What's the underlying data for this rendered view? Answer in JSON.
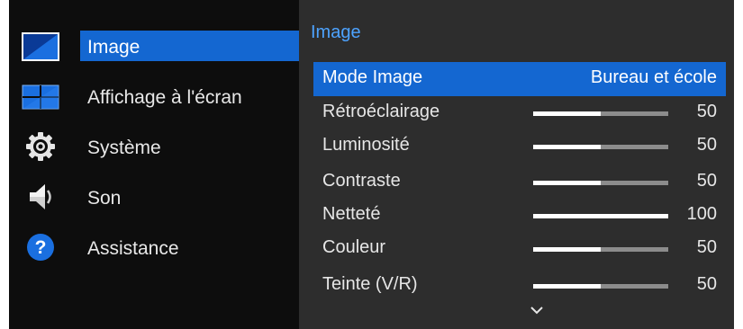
{
  "accent_color": "#1467d1",
  "title_color": "#4da3ff",
  "menu": {
    "items": [
      {
        "label": "Image",
        "icon": "picture-icon",
        "selected": true
      },
      {
        "label": "Affichage à l'écran",
        "icon": "display-icon",
        "selected": false
      },
      {
        "label": "Système",
        "icon": "gear-icon",
        "selected": false
      },
      {
        "label": "Son",
        "icon": "speaker-icon",
        "selected": false
      },
      {
        "label": "Assistance",
        "icon": "help-icon",
        "selected": false
      }
    ]
  },
  "panel": {
    "title": "Image",
    "rows": [
      {
        "label": "Mode Image",
        "value": "Bureau et école",
        "selected": true
      },
      {
        "label": "Rétroéclairage",
        "value": "50",
        "level_percent": 50
      },
      {
        "label": "Luminosité",
        "value": "50",
        "level_percent": 50
      },
      {
        "label": "Contraste",
        "value": "50",
        "level_percent": 50
      },
      {
        "label": "Netteté",
        "value": "100",
        "level_percent": 100
      },
      {
        "label": "Couleur",
        "value": "50",
        "level_percent": 50
      },
      {
        "label": "Teinte (V/R)",
        "value": "50",
        "level_percent": 50
      }
    ],
    "scroll_icon": "chevron-down-icon"
  }
}
